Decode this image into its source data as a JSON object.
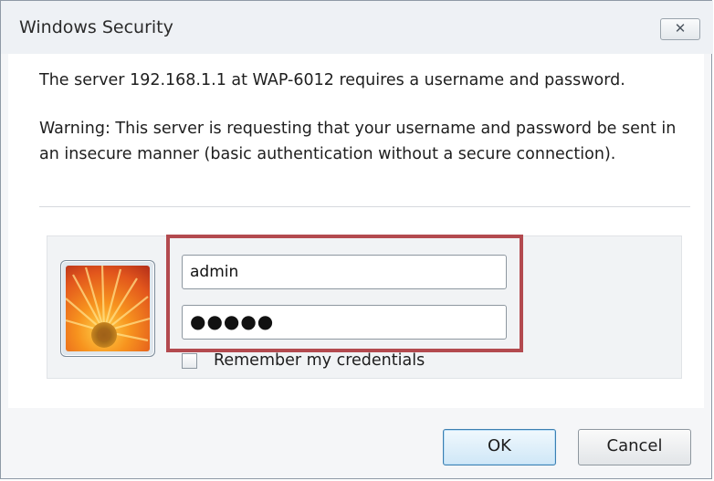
{
  "window": {
    "title": "Windows Security",
    "close_label": "✕"
  },
  "message": {
    "line1": "The server 192.168.1.1 at WAP-6012 requires a username and password.",
    "warning": "Warning: This server is requesting that your username and password be sent in an insecure manner (basic authentication without a secure connection)."
  },
  "credentials": {
    "username_value": "admin",
    "password_value": "●●●●●",
    "remember_label": "Remember my credentials",
    "remember_checked": false
  },
  "buttons": {
    "ok_label": "OK",
    "cancel_label": "Cancel"
  },
  "colors": {
    "highlight": "#b34a4f",
    "ok_border": "#3c7fb1"
  },
  "icons": {
    "avatar": "user-tile-flower-icon",
    "close": "close-icon"
  }
}
